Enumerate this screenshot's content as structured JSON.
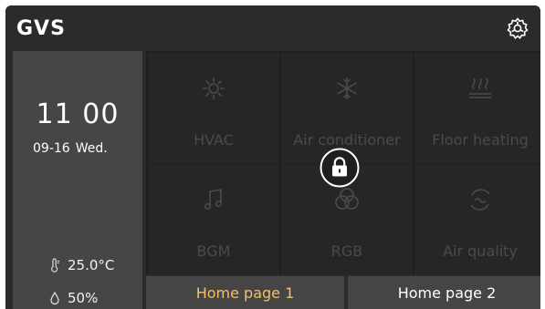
{
  "header": {
    "brand": "GVS",
    "settings_icon": "gear-icon"
  },
  "status": {
    "time": "11 00",
    "date": "09-16",
    "weekday": "Wed.",
    "temperature": "25.0°C",
    "humidity": "50%"
  },
  "tiles": [
    {
      "label": "HVAC",
      "icon": "hvac-icon"
    },
    {
      "label": "Air conditioner",
      "icon": "snowflake-icon"
    },
    {
      "label": "Floor heating",
      "icon": "floor-heating-icon"
    },
    {
      "label": "BGM",
      "icon": "music-icon"
    },
    {
      "label": "RGB",
      "icon": "rgb-icon"
    },
    {
      "label": "Air quality",
      "icon": "air-quality-icon"
    }
  ],
  "tabs": [
    {
      "label": "Home page 1",
      "active": true
    },
    {
      "label": "Home page 2",
      "active": false
    }
  ],
  "colors": {
    "accent": "#f0c070",
    "background": "#2b2b2b",
    "panel": "#464646",
    "tile": "#262626",
    "tile_text": "#4b4b4b"
  }
}
